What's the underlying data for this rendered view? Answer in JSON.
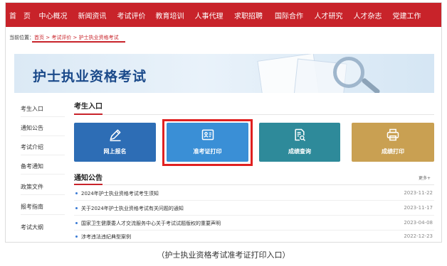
{
  "nav": {
    "items": [
      "首　页",
      "中心概况",
      "新闻资讯",
      "考试评价",
      "教育培训",
      "人事代理",
      "求职招聘",
      "国际合作",
      "人才研究",
      "人才杂志",
      "党建工作"
    ]
  },
  "breadcrumb": {
    "prefix": "当前位置：",
    "home": "首页",
    "sep1": " > ",
    "level2": "考试评价",
    "sep2": " > ",
    "current": "护士执业资格考试"
  },
  "banner": {
    "title": "护士执业资格考试"
  },
  "sidebar": {
    "items": [
      "考生入口",
      "通知公告",
      "考试介绍",
      "备考通知",
      "政策文件",
      "报考指南",
      "考试大纲"
    ]
  },
  "entrance": {
    "title": "考生入口",
    "cards": [
      {
        "label": "网上报名",
        "icon": "pen-icon",
        "color": "#2d6db5"
      },
      {
        "label": "准考证打印",
        "icon": "id-card-icon",
        "color": "#3a8fd6"
      },
      {
        "label": "成绩查询",
        "icon": "document-search-icon",
        "color": "#2e8a9a"
      },
      {
        "label": "成绩打印",
        "icon": "printer-icon",
        "color": "#c9a052"
      }
    ]
  },
  "notices": {
    "title": "通知公告",
    "more": "更多+",
    "items": [
      {
        "text": "2024年护士执业资格考试考生须知",
        "date": "2023-11-22"
      },
      {
        "text": "关于2024年护士执业资格考试有关问题的通知",
        "date": "2023-11-17"
      },
      {
        "text": "国家卫生健康委人才交流服务中心关于考试试题版权的重要声明",
        "date": "2023-04-08"
      },
      {
        "text": "涉考违法违纪典型案例",
        "date": "2022-12-23"
      }
    ]
  },
  "caption": "（护士执业资格考试准考证打印入口）",
  "colors": {
    "accent": "#c8232a",
    "highlight": "#e02020"
  }
}
